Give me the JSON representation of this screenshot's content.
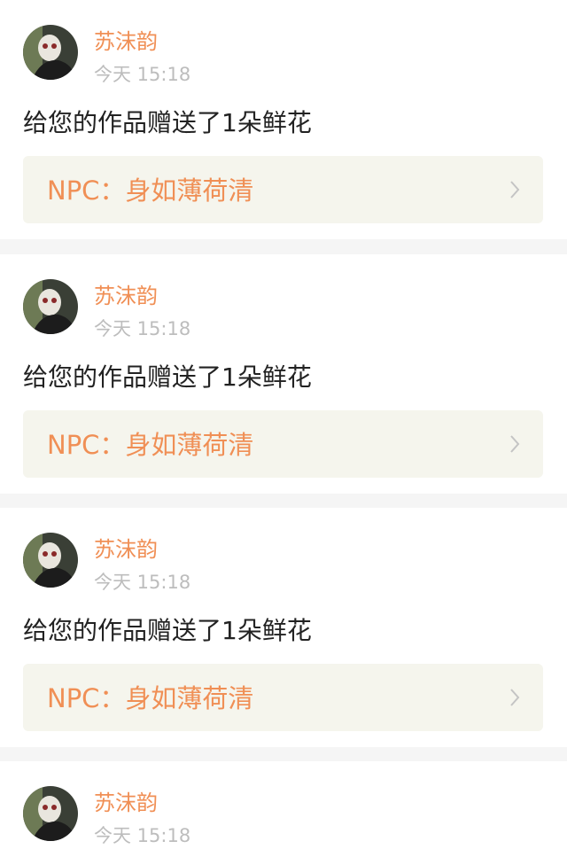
{
  "notifications": [
    {
      "username": "苏沫韵",
      "time": "今天 15:18",
      "message": "给您的作品赠送了1朵鲜花",
      "work_label": "NPC：身如薄荷清"
    },
    {
      "username": "苏沫韵",
      "time": "今天 15:18",
      "message": "给您的作品赠送了1朵鲜花",
      "work_label": "NPC：身如薄荷清"
    },
    {
      "username": "苏沫韵",
      "time": "今天 15:18",
      "message": "给您的作品赠送了1朵鲜花",
      "work_label": "NPC：身如薄荷清"
    },
    {
      "username": "苏沫韵",
      "time": "今天 15:18",
      "message": "",
      "work_label": ""
    }
  ],
  "icons": {
    "avatar": "user-avatar-icon",
    "chevron": "chevron-right-icon"
  },
  "colors": {
    "accent": "#f08f55",
    "time_text": "#bdbdbd",
    "message_text": "#222222",
    "link_bg": "#f5f5ed",
    "page_bg": "#f5f5f5"
  }
}
